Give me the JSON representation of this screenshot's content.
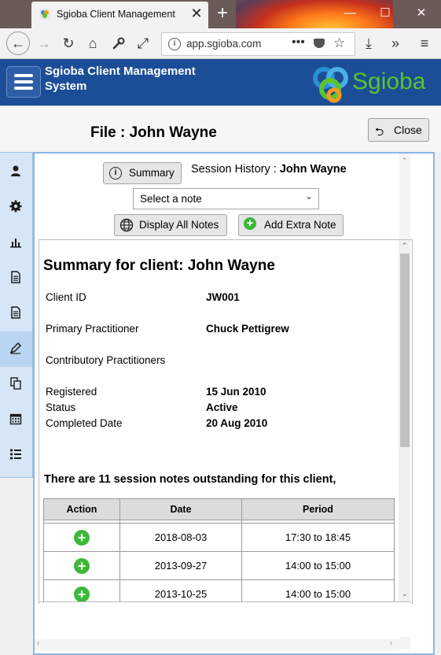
{
  "browser": {
    "tab_title": "Sgioba Client Management",
    "url": "app.sgioba.com",
    "url_dots": "•••"
  },
  "app": {
    "title": "Sgioba Client Management System",
    "brand": "Sgioba"
  },
  "file": {
    "title": "File : John Wayne",
    "close_label": "Close"
  },
  "sidebar": {
    "items": [
      {
        "icon": "person-icon"
      },
      {
        "icon": "gear-icon"
      },
      {
        "icon": "bar-chart-icon"
      },
      {
        "icon": "document-icon"
      },
      {
        "icon": "document-icon"
      },
      {
        "icon": "pen-icon",
        "active": true
      },
      {
        "icon": "copy-icon"
      },
      {
        "icon": "calendar-icon"
      },
      {
        "icon": "list-icon"
      }
    ]
  },
  "toolbar": {
    "summary_label": "Summary",
    "session_history_prefix": "Session History : ",
    "session_history_client": "John Wayne",
    "note_select_value": "Select a note",
    "display_all_label": "Display All Notes",
    "add_note_label": "Add Extra Note"
  },
  "summary": {
    "title": "Summary for client: John Wayne",
    "fields": [
      {
        "label": "Client ID",
        "value": "JW001"
      },
      {
        "label": "Primary Practitioner",
        "value": "Chuck Pettigrew"
      },
      {
        "label": "Contributory Practitioners",
        "value": ""
      },
      {
        "label": "Registered",
        "value": "15 Jun 2010"
      },
      {
        "label": "Status",
        "value": "Active"
      },
      {
        "label": "Completed Date",
        "value": "20 Aug 2010"
      }
    ],
    "outstanding_text": "There are 11 session notes outstanding for this client,"
  },
  "notes_table": {
    "headers": [
      "Action",
      "Date",
      "Period"
    ],
    "rows": [
      {
        "date": "2018-08-03",
        "period": "17:30 to 18:45"
      },
      {
        "date": "2013-09-27",
        "period": "14:00 to 15:00"
      },
      {
        "date": "2013-10-25",
        "period": "14:00 to 15:00"
      }
    ]
  },
  "colors": {
    "header_blue": "#1b4e96",
    "brand_green": "#5cc32e",
    "add_green": "#3db83a",
    "sidebar_bg": "#d7e6f7"
  }
}
